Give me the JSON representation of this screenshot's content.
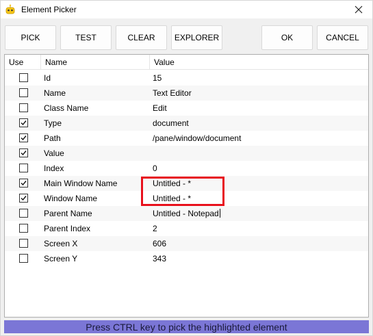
{
  "window": {
    "title": "Element Picker",
    "app_icon": "robot-icon"
  },
  "toolbar": {
    "pick_label": "PICK",
    "test_label": "TEST",
    "clear_label": "CLEAR",
    "explorer_label": "EXPLORER",
    "ok_label": "OK",
    "cancel_label": "CANCEL"
  },
  "table": {
    "headers": {
      "use": "Use",
      "name": "Name",
      "value": "Value"
    },
    "rows": [
      {
        "checked": false,
        "name": "Id",
        "value": "15"
      },
      {
        "checked": false,
        "name": "Name",
        "value": "Text Editor"
      },
      {
        "checked": false,
        "name": "Class Name",
        "value": "Edit"
      },
      {
        "checked": true,
        "name": "Type",
        "value": "document"
      },
      {
        "checked": true,
        "name": "Path",
        "value": "/pane/window/document"
      },
      {
        "checked": true,
        "name": "Value",
        "value": ""
      },
      {
        "checked": false,
        "name": "Index",
        "value": "0"
      },
      {
        "checked": true,
        "name": "Main Window Name",
        "value": "Untitled - *"
      },
      {
        "checked": true,
        "name": "Window Name",
        "value": "Untitled - *"
      },
      {
        "checked": false,
        "name": "Parent Name",
        "value": "Untitled - Notepad"
      },
      {
        "checked": false,
        "name": "Parent Index",
        "value": "2"
      },
      {
        "checked": false,
        "name": "Screen X",
        "value": "606"
      },
      {
        "checked": false,
        "name": "Screen Y",
        "value": "343"
      }
    ]
  },
  "status": {
    "text": "Press CTRL key to pick the highlighted element",
    "color": "#7b76d6"
  },
  "colors": {
    "highlight": "#e8101c"
  }
}
